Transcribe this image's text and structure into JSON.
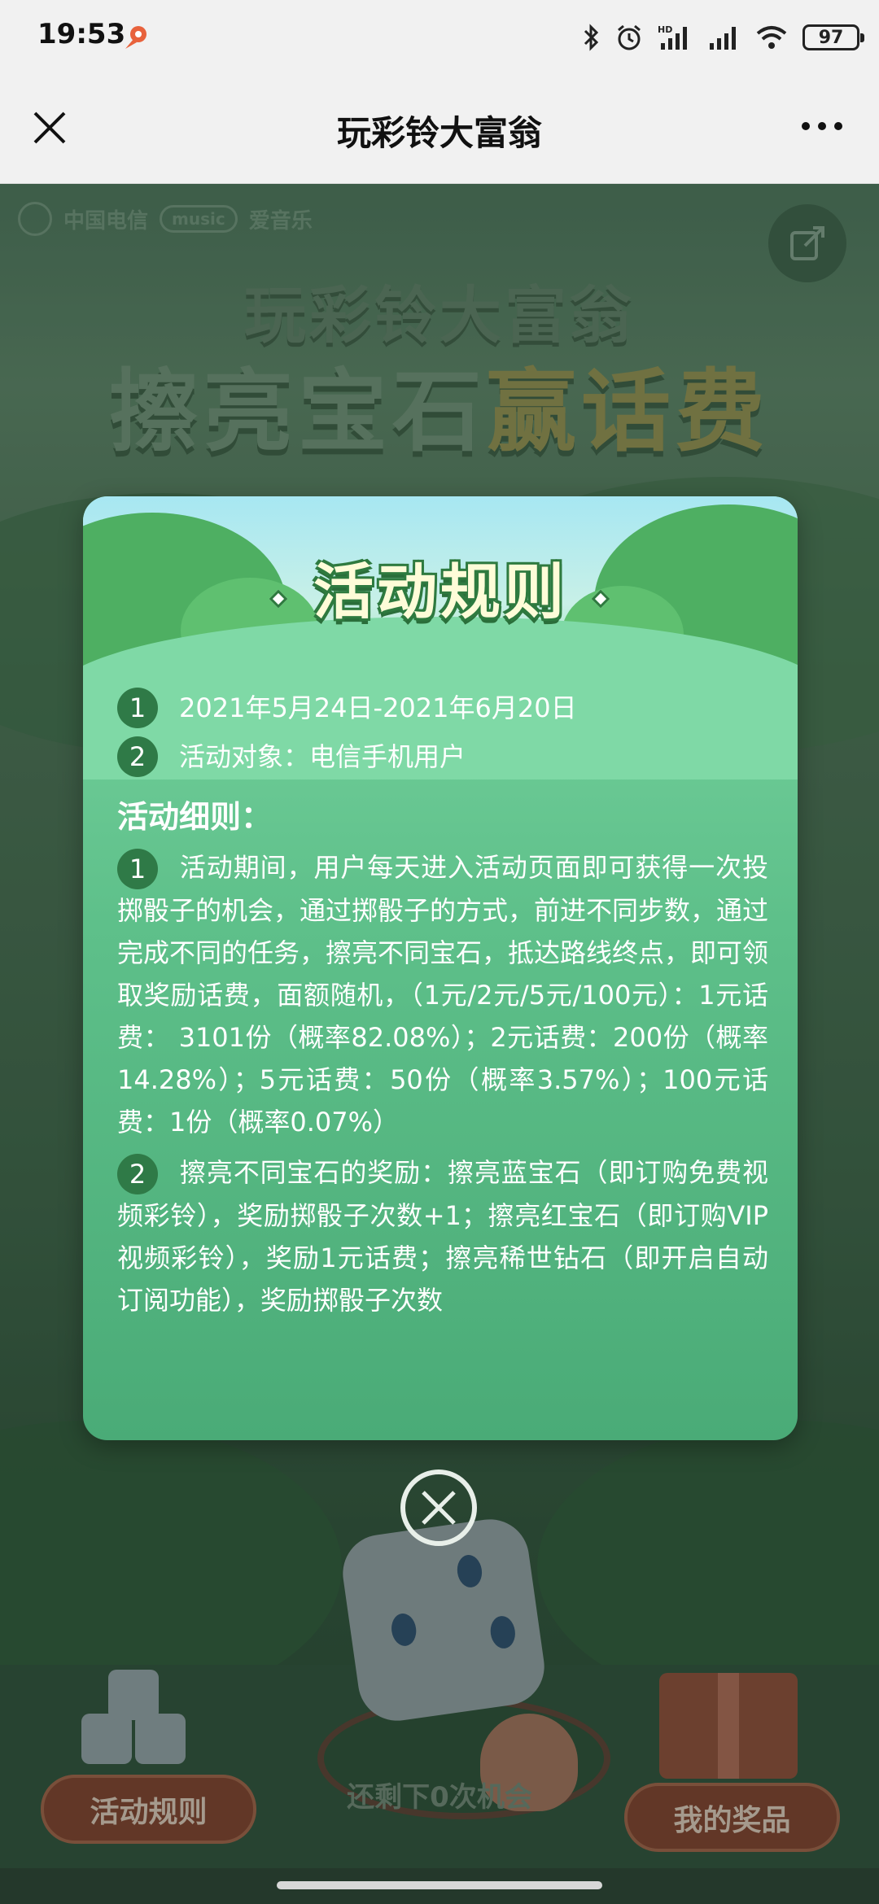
{
  "status_bar": {
    "time": "19:53",
    "battery": "97",
    "network_label": "HD"
  },
  "nav": {
    "title": "玩彩铃大富翁"
  },
  "banner": {
    "brand_telecom": "中国电信",
    "brand_music": "music",
    "brand_music_name": "爱音乐",
    "headline_line1": "玩彩铃大富翁",
    "headline_line2_a": "擦亮宝石",
    "headline_line2_b": "赢话费"
  },
  "modal": {
    "title": "活动规则",
    "items": [
      {
        "num": "1",
        "text": "2021年5月24日-2021年6月20日"
      },
      {
        "num": "2",
        "text": "活动对象：电信手机用户"
      }
    ],
    "details_title": "活动细则：",
    "details": [
      {
        "num": "1",
        "text": "活动期间，用户每天进入活动页面即可获得一次投掷骰子的机会，通过掷骰子的方式，前进不同步数，通过完成不同的任务，擦亮不同宝石，抵达路线终点，即可领取奖励话费，面额随机，（1元/2元/5元/100元）：1元话费： 3101份（概率82.08%）；2元话费：200份（概率14.28%）；5元话费：50份（概率3.57%）；100元话费：1份（概率0.07%）"
      },
      {
        "num": "2",
        "text": "擦亮不同宝石的奖励：擦亮蓝宝石（即订购免费视频彩铃），奖励掷骰子次数+1；擦亮红宝石（即订购VIP视频彩铃），奖励1元话费；擦亮稀世钻石（即开启自动订阅功能），奖励掷骰子次数"
      }
    ]
  },
  "bottom": {
    "rules_button": "活动规则",
    "remaining": "还剩下0次机会",
    "prizes_button": "我的奖品"
  }
}
